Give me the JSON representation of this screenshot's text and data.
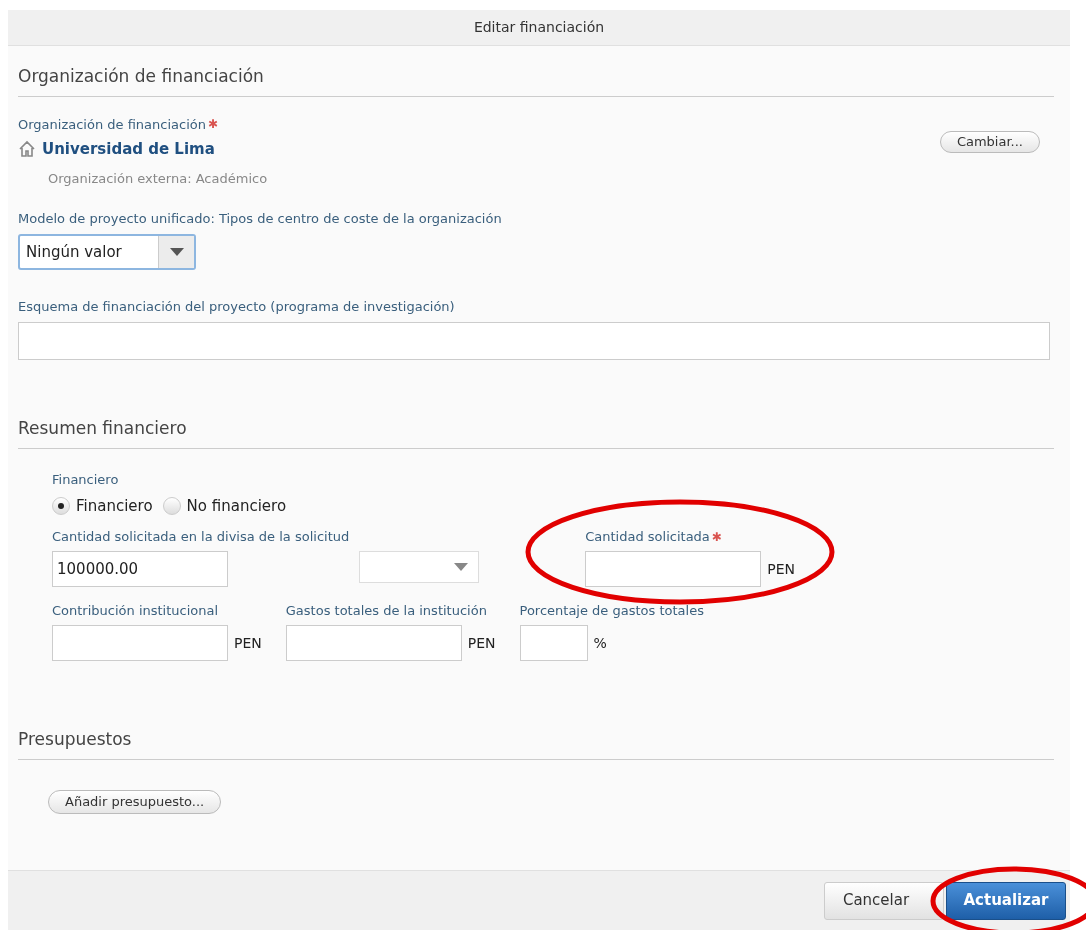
{
  "dialog": {
    "title": "Editar financiación"
  },
  "organization_section": {
    "heading": "Organización de financiación",
    "org_label": "Organización de financiación",
    "required_mark": "✱",
    "org_name": "Universidad de Lima",
    "org_detail": "Organización externa: Académico",
    "change_button": "Cambiar...",
    "model_label": "Modelo de proyecto unificado: Tipos de centro de coste de la organización",
    "model_value": "Ningún valor",
    "scheme_label": "Esquema de financiación del proyecto (programa de investigación)"
  },
  "summary_section": {
    "heading": "Resumen financiero",
    "radio_label": "Financiero",
    "radios": [
      {
        "label": "Financiero",
        "selected": true
      },
      {
        "label": "No financiero",
        "selected": false
      }
    ],
    "fields": [
      {
        "kind": "amount",
        "label": "Cantidad solicitada en la divisa de la solicitud",
        "value": "100000.00",
        "circled": false
      },
      {
        "kind": "currency",
        "circled": false
      },
      {
        "kind": "unit",
        "label": "Cantidad solicitada",
        "required_mark": "✱",
        "unit": "PEN",
        "circled": true
      },
      {
        "kind": "unit",
        "label": "Contribución institucional",
        "unit": "PEN",
        "circled": false
      },
      {
        "kind": "unit",
        "label": "Gastos totales de la institución",
        "unit": "PEN",
        "circled": false
      },
      {
        "kind": "percent",
        "label": "Porcentaje de gastos totales",
        "unit": "%",
        "circled": false
      }
    ]
  },
  "budget_section": {
    "heading": "Presupuestos",
    "add_button": "Añadir presupuesto..."
  },
  "footer": {
    "buttons": [
      {
        "label": "Cancelar",
        "kind": "secondary",
        "circled": false
      },
      {
        "label": "Actualizar",
        "kind": "primary",
        "circled": true
      }
    ]
  }
}
